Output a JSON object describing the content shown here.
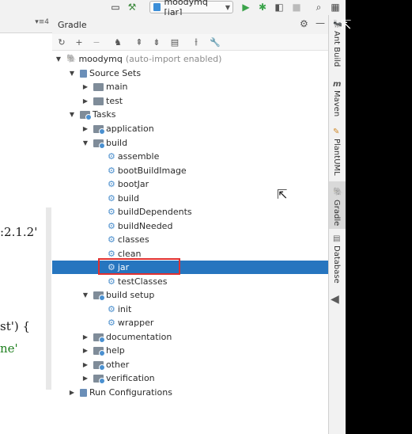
{
  "toolbar": {
    "run_config": "moodymq [jar]"
  },
  "editor": {
    "code_lines": [
      ":2.1.2'",
      "st') {",
      "ne'"
    ]
  },
  "gradle": {
    "title": "Gradle",
    "root": {
      "name": "moodymq",
      "hint": "(auto-import enabled)"
    },
    "tree": {
      "source_sets": "Source Sets",
      "main": "main",
      "test": "test",
      "tasks": "Tasks",
      "application": "application",
      "build": "build",
      "build_tasks": [
        "assemble",
        "bootBuildImage",
        "bootJar",
        "build",
        "buildDependents",
        "buildNeeded",
        "classes",
        "clean",
        "jar",
        "testClasses"
      ],
      "build_setup": "build setup",
      "build_setup_tasks": [
        "init",
        "wrapper"
      ],
      "documentation": "documentation",
      "help": "help",
      "other": "other",
      "verification": "verification",
      "run_configurations": "Run Configurations"
    }
  },
  "right_strip": {
    "ant_build": "Ant Build",
    "maven": "Maven",
    "plantuml": "PlantUML",
    "gradle": "Gradle",
    "database": "Database"
  },
  "colors": {
    "selection": "#2675bf",
    "highlight_box": "#e03030",
    "task_gear": "#4c8fcd"
  }
}
